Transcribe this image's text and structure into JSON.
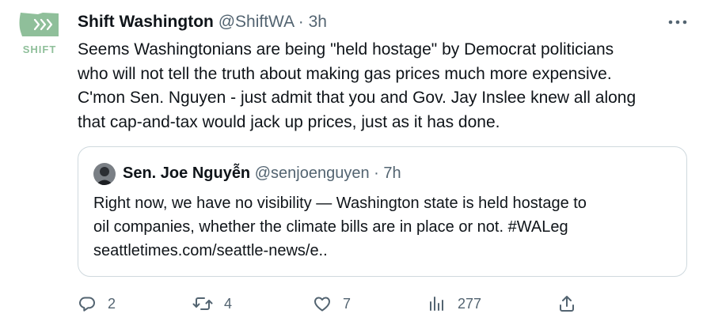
{
  "tweet": {
    "avatar_text": "SHIFT",
    "author_name": "Shift Washington",
    "author_handle": "@ShiftWA",
    "separator": "·",
    "time": "3h",
    "more_icon": "more-horizontal-icon",
    "text_lines": [
      "Seems Washingtonians are being \"held hostage\" by Democrat politicians",
      "who will not tell the truth about making gas prices much more expensive.",
      "C'mon Sen. Nguyen - just admit that you and Gov. Jay Inslee knew all along",
      "that cap-and-tax would jack up prices, just as it has done."
    ]
  },
  "quote": {
    "author_name": "Sen. Joe Nguyễn",
    "author_handle": "@senjoenguyen",
    "separator": "·",
    "time": "7h",
    "text_lines": [
      "Right now, we have no visibility — Washington state is held hostage to",
      "oil companies, whether the climate bills are in place or not. #WALeg",
      "seattletimes.com/seattle-news/e.."
    ]
  },
  "actions": {
    "reply": {
      "icon": "reply-icon",
      "count": "2"
    },
    "retweet": {
      "icon": "retweet-icon",
      "count": "4"
    },
    "like": {
      "icon": "heart-icon",
      "count": "7"
    },
    "views": {
      "icon": "views-icon",
      "count": "277"
    },
    "share": {
      "icon": "share-icon"
    }
  },
  "colors": {
    "text": "#0f1419",
    "secondary": "#536471",
    "border": "#cfd9de",
    "logo_green": "#8fbf9a"
  }
}
